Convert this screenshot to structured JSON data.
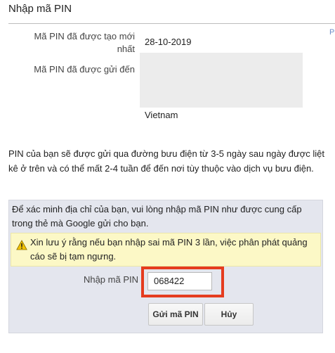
{
  "page_title": "Nhập mã PIN",
  "edge_fragment": "P",
  "details": {
    "created_label": "Mã PIN đã được tạo mới nhất",
    "created_value": "28-10-2019",
    "sent_to_label": "Mã PIN đã được gửi đến",
    "sent_to_country": "Vietnam"
  },
  "delivery_info": "PIN của bạn sẽ được gửi qua đường bưu điện từ 3-5 ngày sau ngày được liệt kê ở trên và có thể mất 2-4 tuần để đến nơi tùy thuộc vào dịch vụ bưu điện.",
  "pin_panel": {
    "intro": "Để xác minh địa chỉ của bạn, vui lòng nhập mã PIN như được cung cấp trong thẻ mà Google gửi cho bạn.",
    "warning": "Xin lưu ý rằng nếu bạn nhập sai mã PIN 3 lần, việc phân phát quảng cáo sẽ bị tạm ngưng.",
    "pin_label": "Nhập mã PIN",
    "pin_value": "068422",
    "submit_label": "Gửi mã PIN",
    "cancel_label": "Hủy"
  },
  "colors": {
    "highlight_border": "#e53c1f",
    "panel_background": "#e4e6ee",
    "warning_background": "#fcf8c6"
  }
}
